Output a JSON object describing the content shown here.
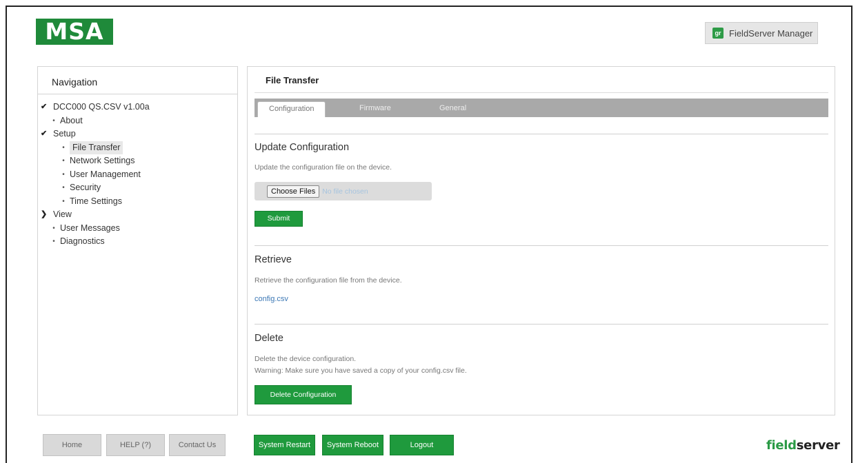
{
  "header": {
    "logo_text": "MSA",
    "fsm_icon_text": "gr",
    "fsm_label": "FieldServer Manager"
  },
  "navigation": {
    "title": "Navigation",
    "items": [
      {
        "label": "DCC000 QS.CSV v1.00a",
        "level": 0,
        "marker": "expanded"
      },
      {
        "label": "About",
        "level": 1,
        "marker": "bullet"
      },
      {
        "label": "Setup",
        "level": 1,
        "marker": "expanded"
      },
      {
        "label": "File Transfer",
        "level": 2,
        "marker": "bullet",
        "selected": true
      },
      {
        "label": "Network Settings",
        "level": 2,
        "marker": "bullet"
      },
      {
        "label": "User Management",
        "level": 2,
        "marker": "bullet"
      },
      {
        "label": "Security",
        "level": 2,
        "marker": "bullet"
      },
      {
        "label": "Time Settings",
        "level": 2,
        "marker": "bullet"
      },
      {
        "label": "View",
        "level": 1,
        "marker": "collapsed"
      },
      {
        "label": "User Messages",
        "level": 1,
        "marker": "bullet"
      },
      {
        "label": "Diagnostics",
        "level": 1,
        "marker": "bullet"
      }
    ]
  },
  "main": {
    "title": "File Transfer",
    "tabs": [
      {
        "label": "Configuration",
        "active": true
      },
      {
        "label": "Firmware",
        "active": false
      },
      {
        "label": "General",
        "active": false
      }
    ],
    "update": {
      "heading": "Update Configuration",
      "description": "Update the configuration file on the device.",
      "choose_label": "Choose Files",
      "file_status": "No file chosen",
      "submit_label": "Submit"
    },
    "retrieve": {
      "heading": "Retrieve",
      "description": "Retrieve the configuration file from the device.",
      "link_label": "config.csv"
    },
    "delete": {
      "heading": "Delete",
      "description": "Delete the device configuration.",
      "warning": "Warning: Make sure you have saved a copy of your config.csv file.",
      "button_label": "Delete Configuration"
    }
  },
  "footer": {
    "home_label": "Home",
    "help_label": "HELP (?)",
    "contact_label": "Contact Us",
    "restart_label": "System Restart",
    "reboot_label": "System Reboot",
    "logout_label": "Logout",
    "brand_accent": "field",
    "brand_rest": "server"
  },
  "colors": {
    "brand_green": "#1f9a3d",
    "tab_bar_gray": "#a9a9a9",
    "link_blue": "#3c78b5"
  }
}
